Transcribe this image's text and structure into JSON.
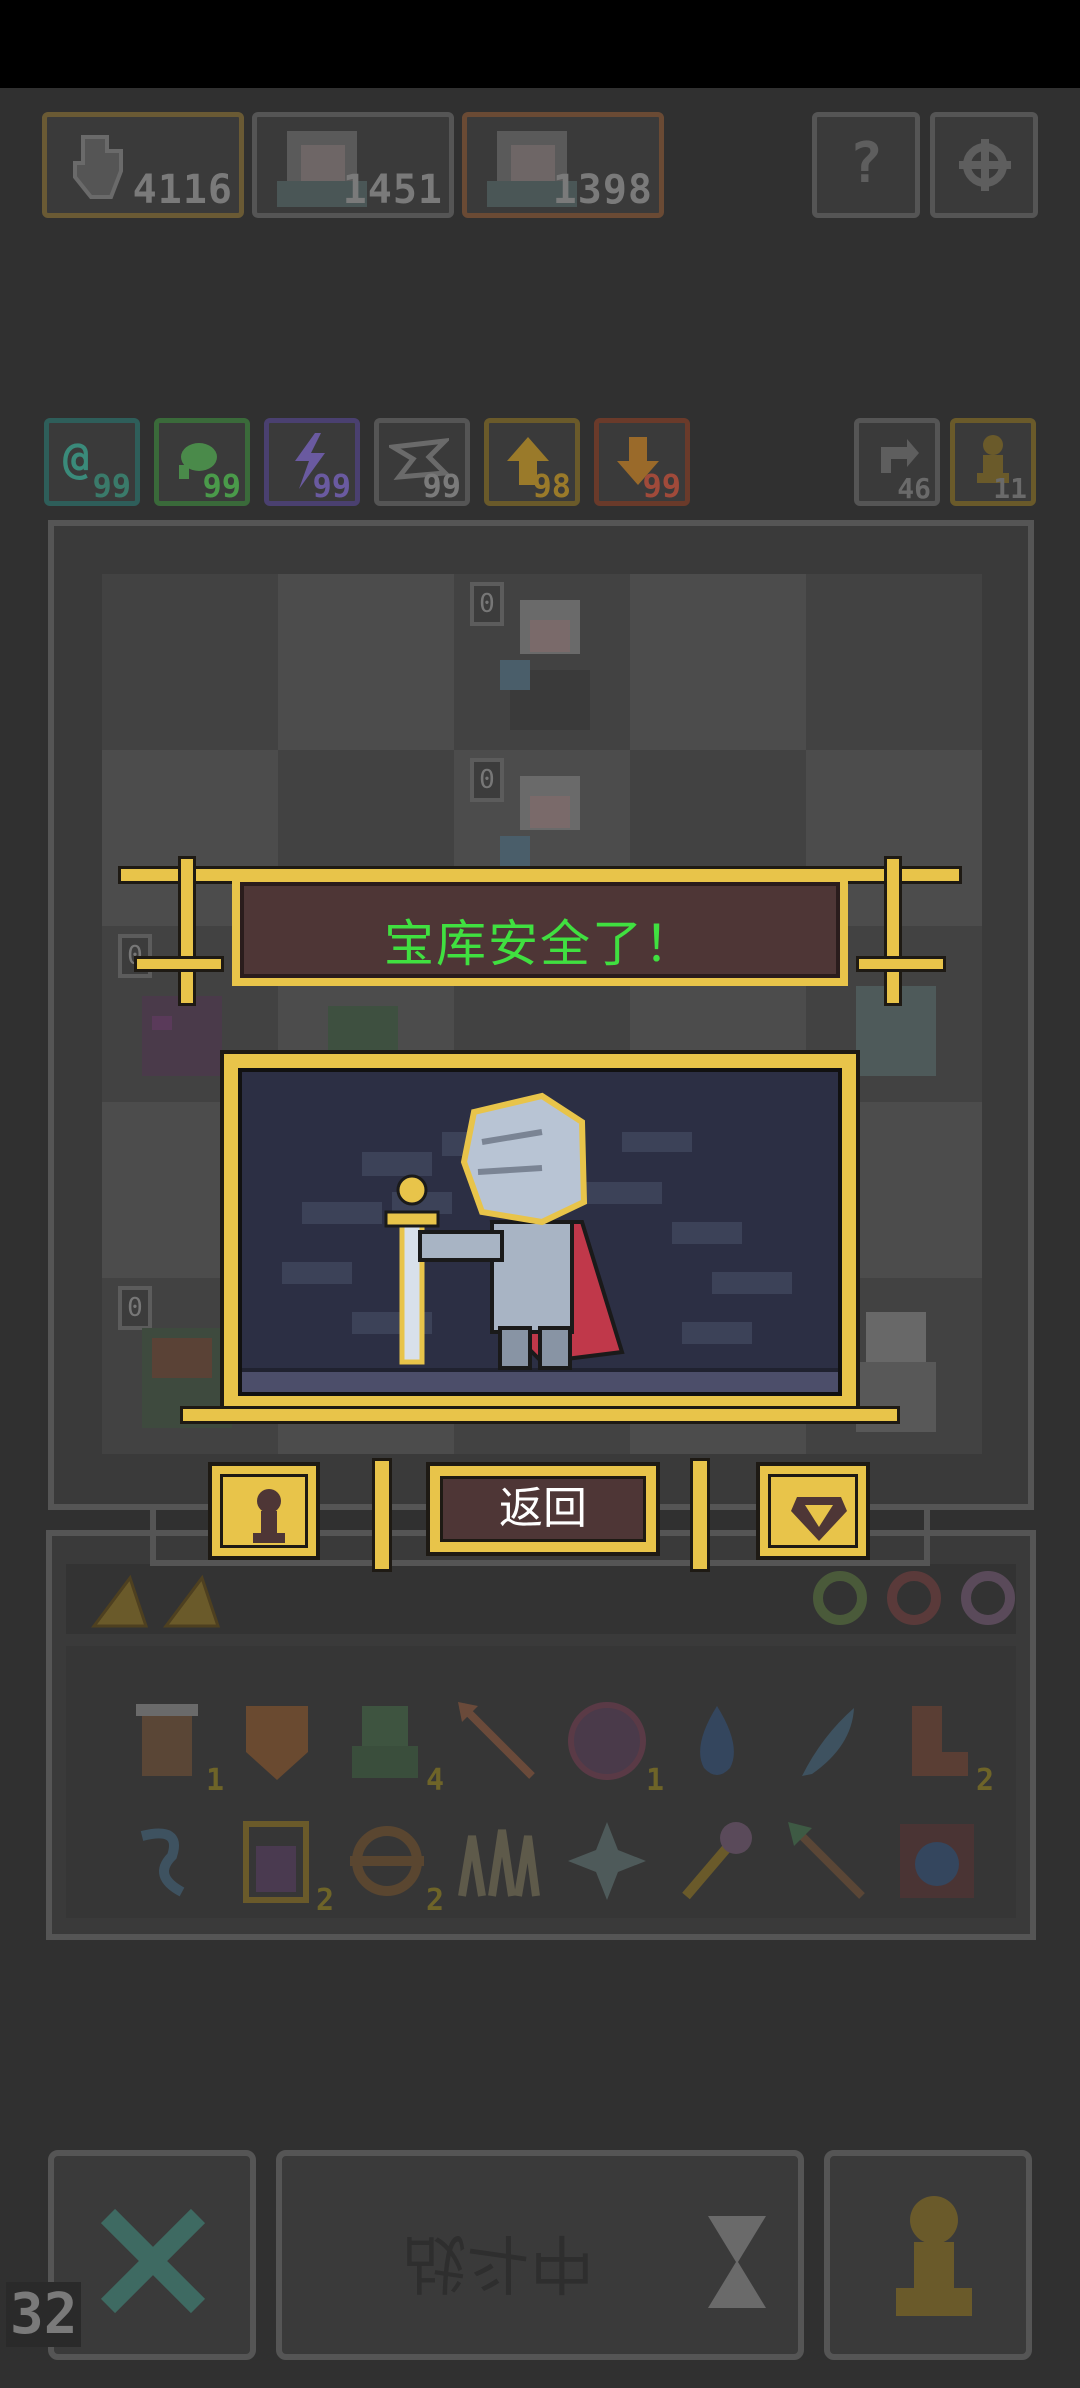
{
  "resources": [
    {
      "id": "player",
      "icon": "hand-icon",
      "value": "4116"
    },
    {
      "id": "hero-1",
      "icon": "hero-portrait-icon",
      "value": "1451"
    },
    {
      "id": "hero-2",
      "icon": "hero-portrait-icon",
      "value": "1398"
    }
  ],
  "top_buttons": [
    {
      "id": "help",
      "icon": "question-mark-icon",
      "label": "?"
    },
    {
      "id": "settings",
      "icon": "gear-icon"
    }
  ],
  "elements": [
    {
      "icon": "swirl-icon",
      "value": "99",
      "color": "#3a8a7a"
    },
    {
      "icon": "leaf-icon",
      "value": "99",
      "color": "#4a9a4a"
    },
    {
      "icon": "lightning-icon",
      "value": "99",
      "color": "#6a5aa0"
    },
    {
      "icon": "wing-icon",
      "value": "99",
      "color": "#7a7a7a"
    },
    {
      "icon": "up-arrow-icon",
      "value": "98",
      "color": "#9a7a2a"
    },
    {
      "icon": "down-arrow-icon",
      "value": "99",
      "color": "#a04a3a"
    }
  ],
  "counters": [
    {
      "icon": "refresh-icon",
      "value": "46"
    },
    {
      "icon": "pawn-icon",
      "value": "11"
    }
  ],
  "board_badges": [
    "0",
    "0",
    "0",
    "0"
  ],
  "modal": {
    "title": "宝库安全了！",
    "back_label": "返回",
    "title_color": "#40e040",
    "frame_color": "#e8c44a"
  },
  "inventory": {
    "row1": [
      {
        "icon": "barrel-icon",
        "count": "1"
      },
      {
        "icon": "shield-icon",
        "count": ""
      },
      {
        "icon": "green-creature-icon",
        "count": "4"
      },
      {
        "icon": "arrow-icon",
        "count": ""
      },
      {
        "icon": "demon-face-icon",
        "count": "1"
      },
      {
        "icon": "water-drop-icon",
        "count": ""
      },
      {
        "icon": "feather-icon",
        "count": ""
      },
      {
        "icon": "boot-icon",
        "count": "2"
      }
    ],
    "row2": [
      {
        "icon": "wind-icon",
        "count": ""
      },
      {
        "icon": "potion-icon",
        "count": "2"
      },
      {
        "icon": "ring-icon",
        "count": "2"
      },
      {
        "icon": "spikes-icon",
        "count": ""
      },
      {
        "icon": "shuriken-icon",
        "count": ""
      },
      {
        "icon": "staff-icon",
        "count": ""
      },
      {
        "icon": "spear-icon",
        "count": ""
      },
      {
        "icon": "fire-scroll-icon",
        "count": ""
      }
    ],
    "gems": [
      "green-gem-icon",
      "red-gem-icon",
      "purple-gem-icon"
    ]
  },
  "bottom_bar": {
    "status_label": "战斗中",
    "fps": "32"
  }
}
